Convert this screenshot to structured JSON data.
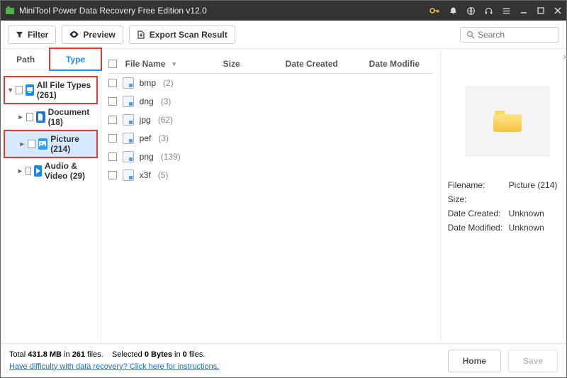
{
  "title": "MiniTool Power Data Recovery Free Edition v12.0",
  "toolbar": {
    "filter": "Filter",
    "preview": "Preview",
    "export": "Export Scan Result",
    "search_placeholder": "Search"
  },
  "tabs": {
    "path": "Path",
    "type": "Type"
  },
  "tree": {
    "root": "All File Types (261)",
    "items": [
      {
        "label": "Document (18)"
      },
      {
        "label": "Picture (214)"
      },
      {
        "label": "Audio & Video (29)"
      }
    ]
  },
  "columns": {
    "filename": "File Name",
    "size": "Size",
    "created": "Date Created",
    "modified": "Date Modifie"
  },
  "files": [
    {
      "name": "bmp",
      "count": "(2)"
    },
    {
      "name": "dng",
      "count": "(3)"
    },
    {
      "name": "jpg",
      "count": "(62)"
    },
    {
      "name": "pef",
      "count": "(3)"
    },
    {
      "name": "png",
      "count": "(139)"
    },
    {
      "name": "x3f",
      "count": "(5)"
    }
  ],
  "details": {
    "filename_label": "Filename:",
    "filename_val": "Picture (214)",
    "size_label": "Size:",
    "size_val": "",
    "created_label": "Date Created:",
    "created_val": "Unknown",
    "modified_label": "Date Modified:",
    "modified_val": "Unknown"
  },
  "footer": {
    "total_prefix": "Total ",
    "total_size": "431.8 MB",
    "total_mid": " in ",
    "total_files": "261",
    "total_suffix": " files.",
    "sel_prefix": "Selected ",
    "sel_bytes": "0 Bytes",
    "sel_mid": " in ",
    "sel_files": "0",
    "sel_suffix": " files.",
    "help": "Have difficulty with data recovery? Click here for instructions.",
    "home": "Home",
    "save": "Save"
  }
}
